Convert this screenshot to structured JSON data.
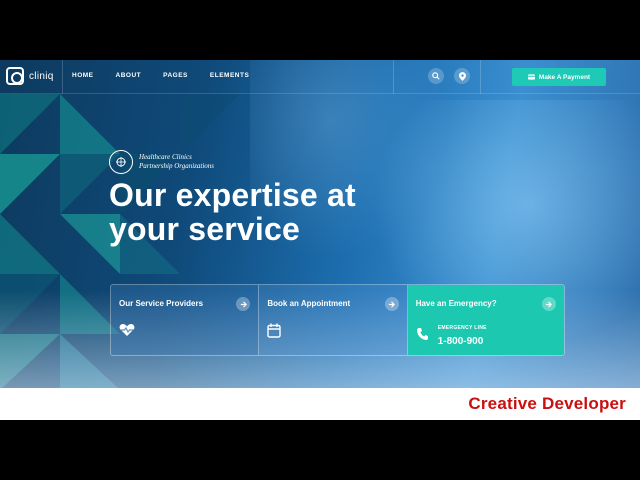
{
  "navbar": {
    "logo_text": "cliniq",
    "links": [
      "HOME",
      "ABOUT",
      "PAGES",
      "ELEMENTS"
    ],
    "search_icon": "search-icon",
    "location_icon": "location-pin-icon",
    "payment_button": "Make A Payment"
  },
  "hero": {
    "badge_line1": "Healthcare Clinics",
    "badge_line2": "Partnership Organizations",
    "headline_line1": "Our expertise at",
    "headline_line2": "your service"
  },
  "cards": [
    {
      "title": "Our Service Providers",
      "icon": "heart-pulse-icon"
    },
    {
      "title": "Book an Appointment",
      "icon": "calendar-icon"
    },
    {
      "title": "Have an Emergency?",
      "icon": "phone-icon",
      "label": "EMERGENCY LINE",
      "number": "1-800-900"
    }
  ],
  "banner": {
    "text": "Creative Developer"
  },
  "colors": {
    "accent": "#1ec9b6",
    "banner_text": "#c81010",
    "hero_dark": "#0d3a5e"
  }
}
